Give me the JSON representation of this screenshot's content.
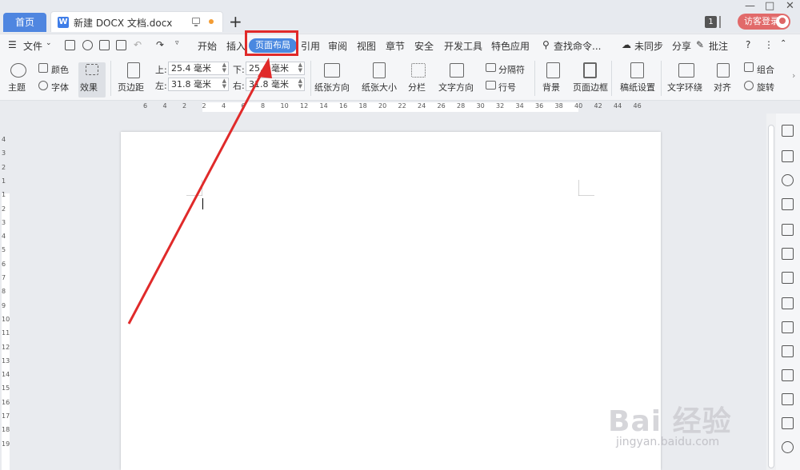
{
  "tabs": {
    "home": "首页",
    "document": "新建 DOCX 文档.docx",
    "new_tab": "+"
  },
  "window": {
    "page_count_badge": "1",
    "login": "访客登录"
  },
  "menu": {
    "file": "文件",
    "items": [
      "开始",
      "插入",
      "页面布局",
      "引用",
      "审阅",
      "视图",
      "章节",
      "安全",
      "开发工具",
      "特色应用"
    ],
    "active": "页面布局",
    "search": "查找命令...",
    "sync": "未同步",
    "share": "分享",
    "comment": "批注"
  },
  "ribbon": {
    "theme": "主题",
    "color": "颜色",
    "font": "字体",
    "effect": "效果",
    "margins": "页边距",
    "top_label": "上:",
    "top_value": "25.4 毫米",
    "bottom_label": "下:",
    "bottom_value": "25.4 毫米",
    "left_label": "左:",
    "left_value": "31.8 毫米",
    "right_label": "右:",
    "right_value": "31.8 毫米",
    "orientation": "纸张方向",
    "size": "纸张大小",
    "columns": "分栏",
    "text_direction": "文字方向",
    "breaks": "分隔符",
    "line_numbers": "行号",
    "background": "背景",
    "page_border": "页面边框",
    "paper_setup": "稿纸设置",
    "text_wrap": "文字环绕",
    "align": "对齐",
    "group": "组合",
    "rotate": "旋转"
  },
  "ruler": {
    "h_ticks": [
      "6",
      "4",
      "2",
      "2",
      "4",
      "6",
      "8",
      "10",
      "12",
      "14",
      "16",
      "18",
      "20",
      "22",
      "24",
      "26",
      "28",
      "30",
      "32",
      "34",
      "36",
      "38",
      "40",
      "42",
      "44",
      "46"
    ],
    "v_ticks": [
      "4",
      "3",
      "2",
      "1",
      "1",
      "2",
      "3",
      "4",
      "5",
      "6",
      "7",
      "8",
      "9",
      "10",
      "11",
      "12",
      "13",
      "14",
      "15",
      "16",
      "17",
      "18",
      "19"
    ]
  },
  "watermark": {
    "brand": "Bai 经验",
    "url": "jingyan.baidu.com"
  },
  "colors": {
    "accent": "#4a88e0",
    "highlight": "#e02a2a",
    "login": "#e16a6a"
  }
}
